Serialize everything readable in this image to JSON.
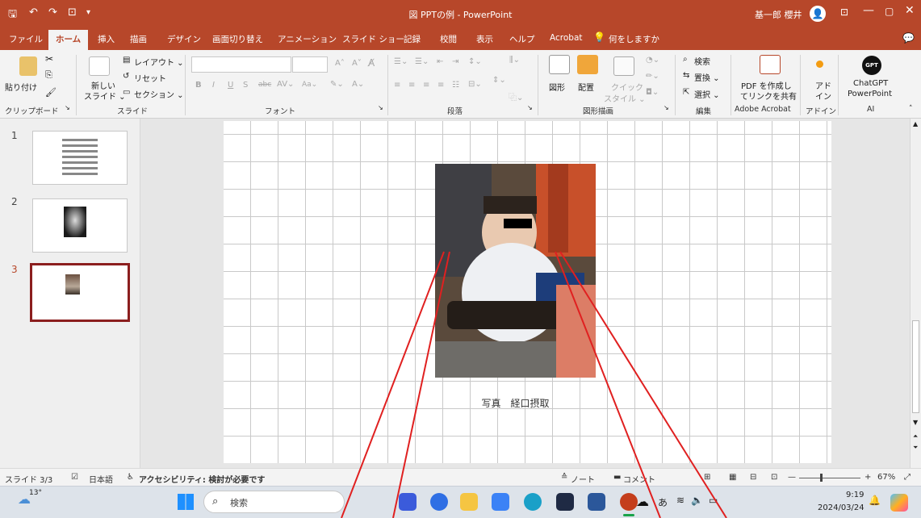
{
  "window": {
    "title": "図 PPTの例 - PowerPoint",
    "user": "基一郎 櫻井"
  },
  "tabs": [
    "ファイル",
    "ホーム",
    "挿入",
    "描画",
    "デザイン",
    "画面切り替え",
    "アニメーション",
    "スライド ショー",
    "記録",
    "校閲",
    "表示",
    "ヘルプ",
    "Acrobat",
    "何をしますか"
  ],
  "ribbon": {
    "clipboard": {
      "paste": "貼り付け",
      "label": "クリップボード"
    },
    "slides": {
      "new_slide": "新しい",
      "new_slide2": "スライド ⌄",
      "layout": "レイアウト ⌄",
      "reset": "リセット",
      "section": "セクション ⌄",
      "label": "スライド"
    },
    "font": {
      "label": "フォント",
      "bold": "B",
      "italic": "I",
      "underline": "U",
      "strike": "S"
    },
    "paragraph": {
      "label": "段落"
    },
    "drawing": {
      "shapes": "図形",
      "arrange": "配置",
      "quick": "クイック",
      "style": "スタイル ⌄",
      "label": "図形描画"
    },
    "editing": {
      "find": "検索",
      "replace": "置換 ⌄",
      "select": "選択 ⌄",
      "label": "編集"
    },
    "acrobat": {
      "l1": "PDF を作成し",
      "l2": "てリンクを共有",
      "label": "Adobe Acrobat"
    },
    "addin": {
      "l1": "アド",
      "l2": "イン",
      "label": "アドイン"
    },
    "ai": {
      "l1": "ChatGPT",
      "l2": "PowerPoint",
      "label": "AI",
      "logo": "GPT"
    }
  },
  "slides_pane": {
    "numbers": [
      "1",
      "2",
      "3"
    ],
    "selected": 3
  },
  "slide": {
    "caption": "写真　経口摂取"
  },
  "status": {
    "slide": "スライド 3/3",
    "lang": "日本語",
    "accessibility": "アクセシビリティ: 検討が必要です",
    "notes": "ノート",
    "comments": "コメント",
    "zoom": "67%"
  },
  "taskbar": {
    "weather": "13°",
    "search": "検索",
    "ime": "あ",
    "time": "9:19",
    "date": "2024/03/24"
  },
  "colors": {
    "accent": "#b7472a",
    "selected_border": "#8b1e1e",
    "annotation_line": "#e02020"
  }
}
